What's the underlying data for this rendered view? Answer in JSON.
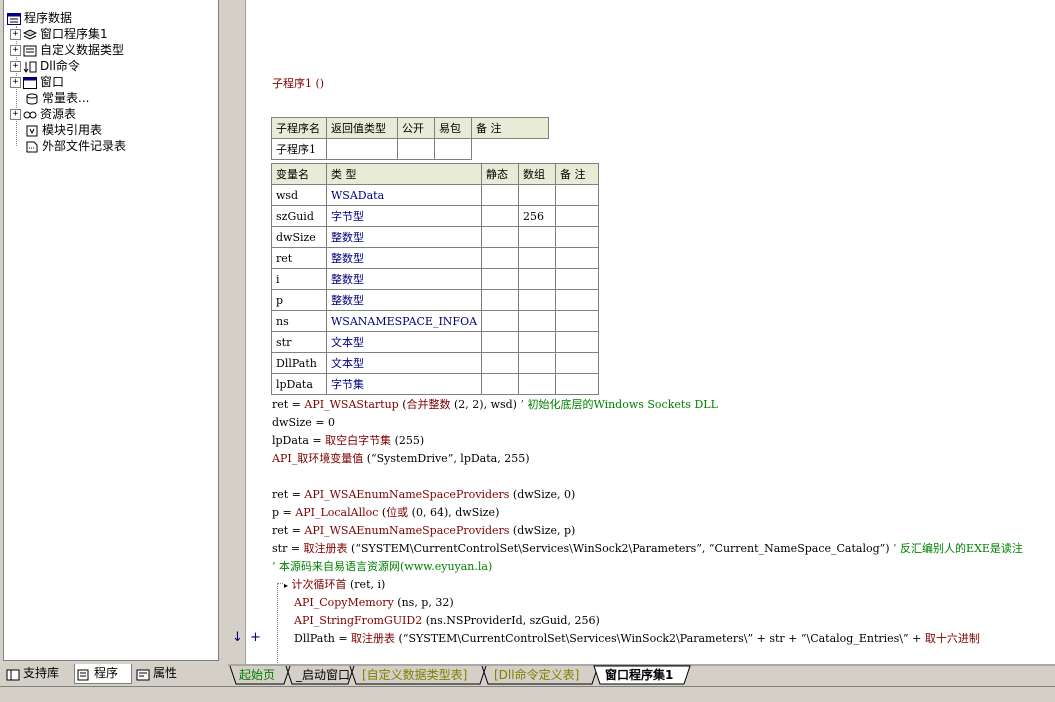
{
  "tree": {
    "root": "程序数据",
    "items": [
      {
        "label": "窗口程序集1",
        "icon": "assembly-icon",
        "expandable": true
      },
      {
        "label": "自定义数据类型",
        "icon": "datatype-icon",
        "expandable": true
      },
      {
        "label": "Dll命令",
        "icon": "dll-icon",
        "expandable": true
      },
      {
        "label": "窗口",
        "icon": "window-icon",
        "expandable": true
      },
      {
        "label": "常量表...",
        "icon": "constant-icon",
        "expandable": false
      },
      {
        "label": "资源表",
        "icon": "resource-icon",
        "expandable": true
      },
      {
        "label": "模块引用表",
        "icon": "module-icon",
        "expandable": false
      },
      {
        "label": "外部文件记录表",
        "icon": "file-icon",
        "expandable": false
      }
    ]
  },
  "left_tabs": [
    {
      "label": "支持库",
      "icon": "library-icon"
    },
    {
      "label": "程序",
      "icon": "program-icon"
    },
    {
      "label": "属性",
      "icon": "property-icon"
    }
  ],
  "editor": {
    "sub_header": "子程序1 ()",
    "sub_table": {
      "headers": [
        "子程序名",
        "返回值类型",
        "公开",
        "易包",
        "备 注"
      ],
      "row": [
        "子程序1",
        "",
        "",
        "",
        ""
      ]
    },
    "var_table": {
      "headers": [
        "变量名",
        "类 型",
        "静态",
        "数组",
        "备 注"
      ],
      "rows": [
        [
          "wsd",
          "WSAData",
          "",
          "",
          ""
        ],
        [
          "szGuid",
          "字节型",
          "",
          "256",
          ""
        ],
        [
          "dwSize",
          "整数型",
          "",
          "",
          ""
        ],
        [
          "ret",
          "整数型",
          "",
          "",
          ""
        ],
        [
          "i",
          "整数型",
          "",
          "",
          ""
        ],
        [
          "p",
          "整数型",
          "",
          "",
          ""
        ],
        [
          "ns",
          "WSANAMESPACE_INFOA",
          "",
          "",
          ""
        ],
        [
          "str",
          "文本型",
          "",
          "",
          ""
        ],
        [
          "DllPath",
          "文本型",
          "",
          "",
          ""
        ],
        [
          "lpData",
          "字节集",
          "",
          "",
          ""
        ]
      ]
    },
    "code": {
      "l1a": "ret = ",
      "l1b": "API_WSAStartup",
      "l1c": " (",
      "l1d": "合并整数",
      "l1e": " (2, 2), wsd)",
      "l1f": "  ’ 初始化底层的Windows Sockets DLL",
      "l2": "dwSize = 0",
      "l3a": "lpData = ",
      "l3b": "取空白字节集",
      "l3c": " (255)",
      "l4a": "API_取环境变量值",
      "l4b": " (“SystemDrive”, lpData, 255)",
      "l5a": "ret = ",
      "l5b": "API_WSAEnumNameSpaceProviders",
      "l5c": " (dwSize, 0)",
      "l6a": "p = ",
      "l6b": "API_LocalAlloc",
      "l6c": " (",
      "l6d": "位或",
      "l6e": " (0, 64), dwSize)",
      "l7a": "ret = ",
      "l7b": "API_WSAEnumNameSpaceProviders",
      "l7c": " (dwSize, p)",
      "l8a": "str = ",
      "l8b": "取注册表",
      "l8c": " (“SYSTEM\\CurrentControlSet\\Services\\WinSock2\\Parameters”, “Current_NameSpace_Catalog”)",
      "l8d": "  ’ 反汇编别人的EXE是读注",
      "l9": "’ 本源码来自易语言资源网(www.eyuyan.la)",
      "l10a": "计次循环首",
      "l10b": " (ret, i)",
      "l11a": "API_CopyMemory",
      "l11b": " (ns, p, 32)",
      "l12a": "API_StringFromGUID2",
      "l12b": " (ns.NSProviderId, szGuid, 256)",
      "l13a": "DllPath = ",
      "l13b": "取注册表",
      "l13c": " (“SYSTEM\\CurrentControlSet\\Services\\WinSock2\\Parameters\\” + str + “\\Catalog_Entries\\” + ",
      "l13d": "取十六进制"
    }
  },
  "bottom_tabs": [
    "起始页",
    "_启动窗口",
    "[自定义数据类型表]",
    "[Dll命令定义表]",
    "窗口程序集1"
  ]
}
